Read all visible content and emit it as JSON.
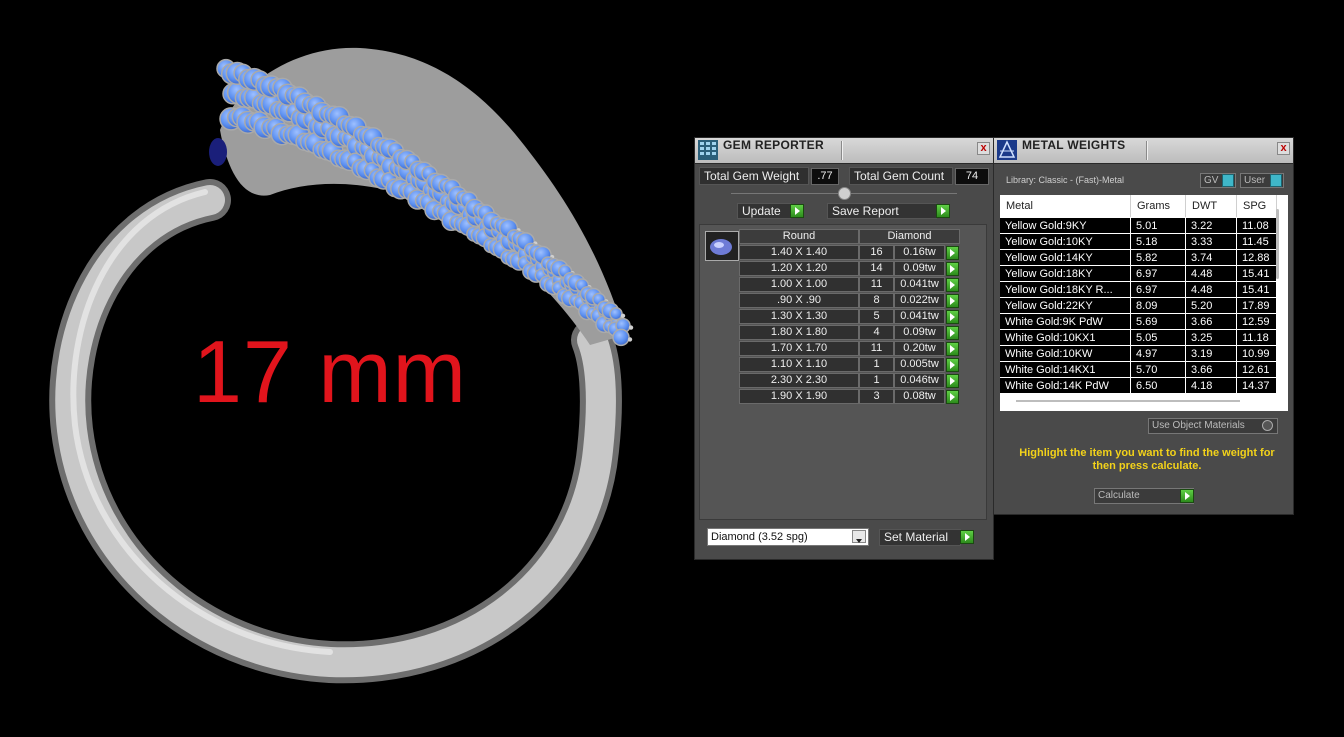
{
  "viewport": {
    "size_label": "17 mm",
    "colors": {
      "ring": "#b9b9b9",
      "gem": "#5b8ff0",
      "label": "#e1141c"
    }
  },
  "gem_reporter": {
    "title": "GEM REPORTER",
    "close": "x",
    "total_weight_label": "Total Gem Weight",
    "total_weight_value": ".77",
    "total_count_label": "Total Gem Count",
    "total_count_value": "74",
    "update_label": "Update",
    "save_report_label": "Save Report",
    "table": {
      "shape": "Round",
      "material": "Diamond",
      "rows": [
        {
          "size": "1.40 X 1.40",
          "count": "16",
          "weight": "0.16tw"
        },
        {
          "size": "1.20 X 1.20",
          "count": "14",
          "weight": "0.09tw"
        },
        {
          "size": "1.00 X 1.00",
          "count": "11",
          "weight": "0.041tw"
        },
        {
          "size": ".90 X .90",
          "count": "8",
          "weight": "0.022tw"
        },
        {
          "size": "1.30 X 1.30",
          "count": "5",
          "weight": "0.041tw"
        },
        {
          "size": "1.80 X 1.80",
          "count": "4",
          "weight": "0.09tw"
        },
        {
          "size": "1.70 X 1.70",
          "count": "11",
          "weight": "0.20tw"
        },
        {
          "size": "1.10 X 1.10",
          "count": "1",
          "weight": "0.005tw"
        },
        {
          "size": "2.30 X 2.30",
          "count": "1",
          "weight": "0.046tw"
        },
        {
          "size": "1.90 X 1.90",
          "count": "3",
          "weight": "0.08tw"
        }
      ]
    },
    "material_select": "Diamond     (3.52 spg)",
    "set_material_label": "Set Material"
  },
  "metal_weights": {
    "title": "METAL WEIGHTS",
    "close": "x",
    "library": "Library: Classic - (Fast)-Metal",
    "gv_label": "GV",
    "user_label": "User",
    "columns": [
      "Metal",
      "Grams",
      "DWT",
      "SPG"
    ],
    "rows": [
      {
        "metal": "Yellow Gold:9KY",
        "grams": "5.01",
        "dwt": "3.22",
        "spg": "11.08"
      },
      {
        "metal": "Yellow Gold:10KY",
        "grams": "5.18",
        "dwt": "3.33",
        "spg": "11.45"
      },
      {
        "metal": "Yellow Gold:14KY",
        "grams": "5.82",
        "dwt": "3.74",
        "spg": "12.88"
      },
      {
        "metal": "Yellow Gold:18KY",
        "grams": "6.97",
        "dwt": "4.48",
        "spg": "15.41"
      },
      {
        "metal": "Yellow Gold:18KY R...",
        "grams": "6.97",
        "dwt": "4.48",
        "spg": "15.41"
      },
      {
        "metal": "Yellow Gold:22KY",
        "grams": "8.09",
        "dwt": "5.20",
        "spg": "17.89"
      },
      {
        "metal": "White Gold:9K PdW",
        "grams": "5.69",
        "dwt": "3.66",
        "spg": "12.59"
      },
      {
        "metal": "White Gold:10KX1",
        "grams": "5.05",
        "dwt": "3.25",
        "spg": "11.18"
      },
      {
        "metal": "White Gold:10KW",
        "grams": "4.97",
        "dwt": "3.19",
        "spg": "10.99"
      },
      {
        "metal": "White Gold:14KX1",
        "grams": "5.70",
        "dwt": "3.66",
        "spg": "12.61"
      },
      {
        "metal": "White Gold:14K PdW",
        "grams": "6.50",
        "dwt": "4.18",
        "spg": "14.37"
      }
    ],
    "use_object_materials": "Use Object Materials",
    "hint": "Highlight the item you want to find the weight for then press calculate.",
    "calculate_label": "Calculate"
  }
}
